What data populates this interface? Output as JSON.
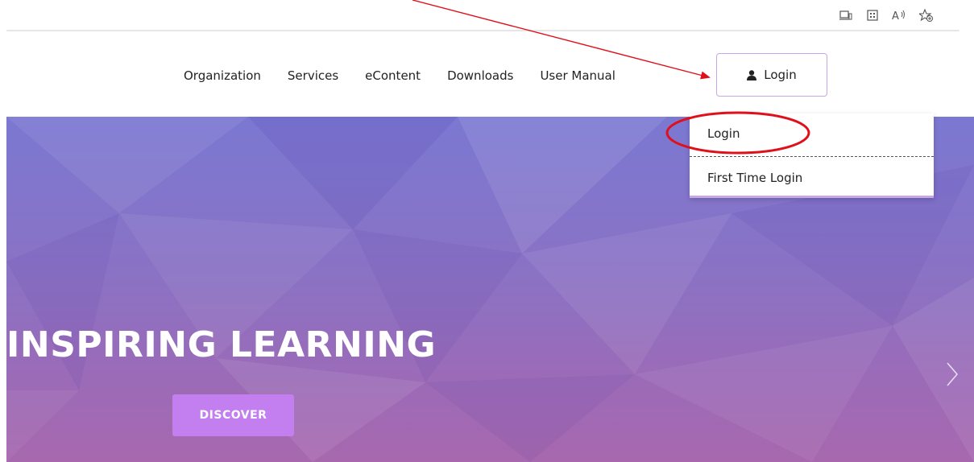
{
  "browser_toolbar": {
    "icons": [
      "device-icon",
      "qr-code-icon",
      "read-aloud-icon",
      "add-favorite-icon"
    ]
  },
  "nav": {
    "items": [
      "Organization",
      "Services",
      "eContent",
      "Downloads",
      "User Manual"
    ],
    "login_label": "Login"
  },
  "dropdown": {
    "items": [
      "Login",
      "First Time Login"
    ]
  },
  "hero": {
    "title": "INSPIRING LEARNING",
    "button_label": "DISCOVER"
  },
  "colors": {
    "accent": "#c37ef0",
    "annotation": "#e0101a",
    "hero_top": "#7b78d2",
    "hero_bottom": "#a768ae"
  }
}
